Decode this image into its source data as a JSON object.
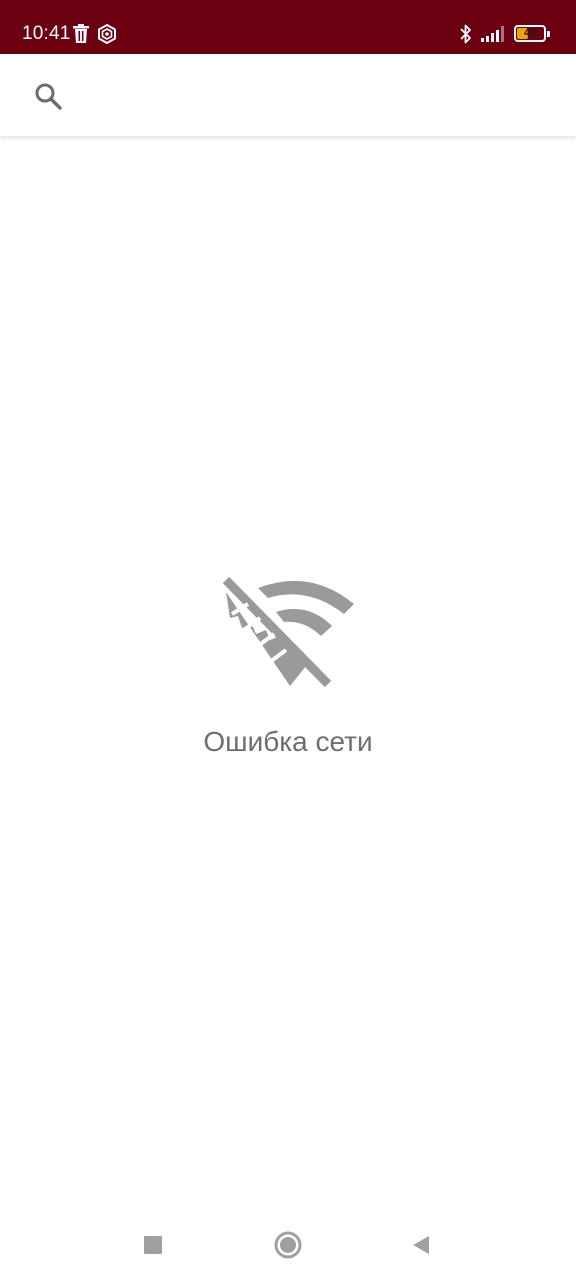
{
  "status_bar": {
    "time": "10:41",
    "battery_level": "41",
    "background_color": "#6b0010",
    "battery_fill_percent": 41,
    "icons": [
      "trash-icon",
      "hexagon-settings-icon",
      "bluetooth-icon",
      "signal-icon",
      "battery-icon"
    ]
  },
  "search": {
    "icon": "search-icon"
  },
  "error": {
    "icon": "wifi-off-icon",
    "message": "Ошибка сети"
  },
  "nav_bar": {
    "icons": [
      "recents-square-icon",
      "home-circle-icon",
      "back-triangle-icon"
    ]
  }
}
